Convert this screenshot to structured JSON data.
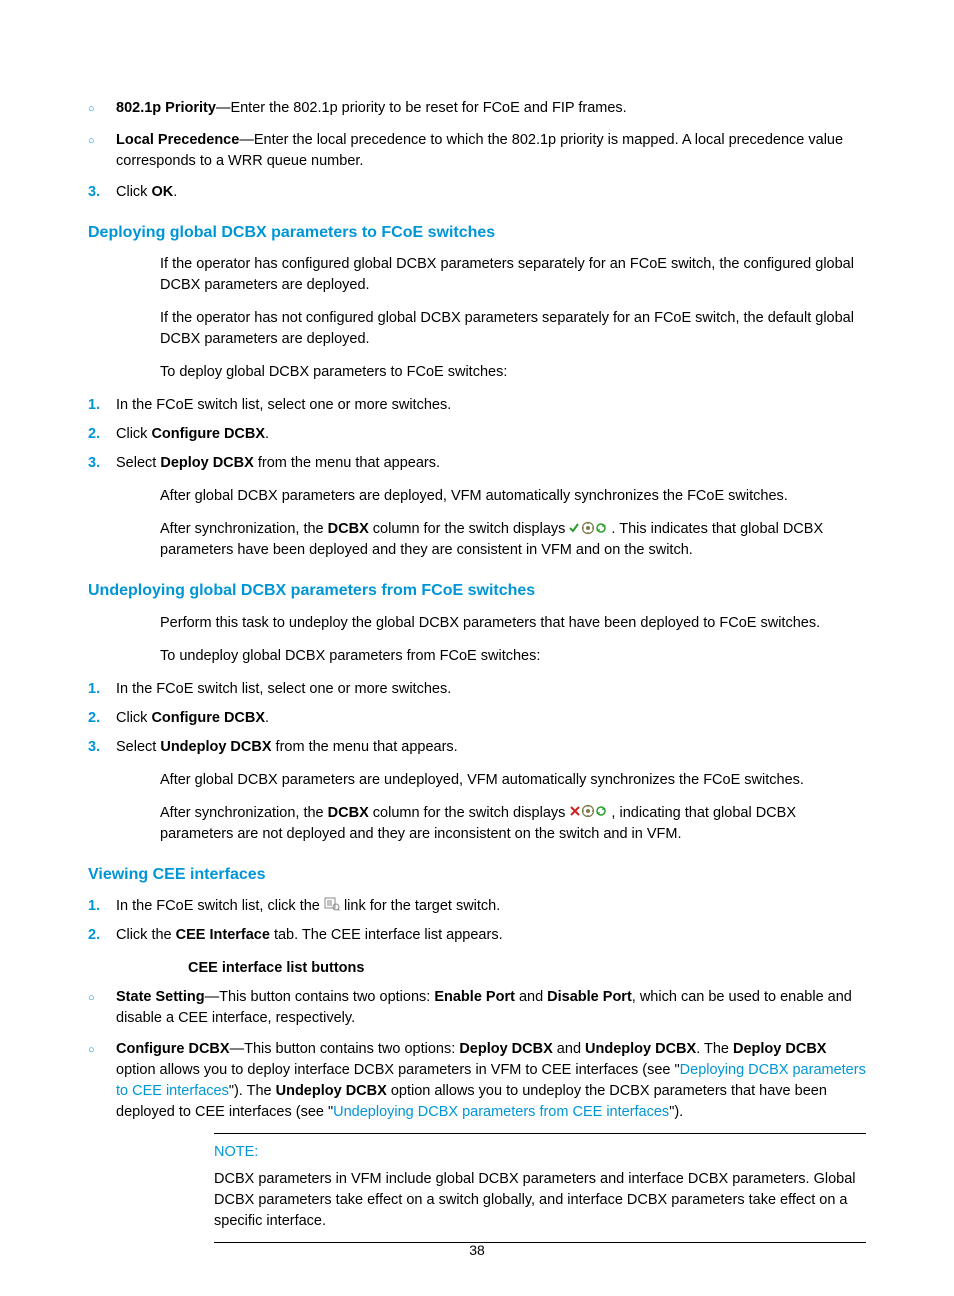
{
  "top": {
    "sub_items": {
      "i1": {
        "term": "802.1p Priority",
        "rest": "—Enter the 802.1p priority to be reset for FCoE and FIP frames."
      },
      "i2": {
        "term": "Local Precedence",
        "rest": "—Enter the local precedence to which the 802.1p priority is mapped. A local precedence value corresponds to a WRR queue number."
      }
    },
    "step3": {
      "n": "3.",
      "pre": "Click ",
      "ok": "OK",
      "post": "."
    }
  },
  "deploy": {
    "heading": "Deploying global DCBX parameters to FCoE switches",
    "p1": "If the operator has configured global DCBX parameters separately for an FCoE switch, the configured global DCBX parameters are deployed.",
    "p2": "If the operator has not configured global DCBX parameters separately for an FCoE switch, the default global DCBX parameters are deployed.",
    "p3": "To deploy global DCBX parameters to FCoE switches:",
    "steps": {
      "s1": {
        "n": "1.",
        "txt": "In the FCoE switch list, select one or more switches."
      },
      "s2": {
        "n": "2.",
        "pre": "Click ",
        "b": "Configure DCBX",
        "post": "."
      },
      "s3": {
        "n": "3.",
        "pre": "Select ",
        "b": "Deploy DCBX",
        "post": " from the menu that appears."
      }
    },
    "p4": "After global DCBX parameters are deployed, VFM automatically synchronizes the FCoE switches.",
    "p5a": "After synchronization, the ",
    "p5b": "DCBX",
    "p5c": " column for the switch displays ",
    "p5d": ". This indicates that global DCBX parameters have been deployed and they are consistent in VFM and on the switch."
  },
  "undeploy": {
    "heading": "Undeploying global DCBX parameters from FCoE switches",
    "p1": "Perform this task to undeploy the global DCBX parameters that have been deployed to FCoE switches.",
    "p2": "To undeploy global DCBX parameters from FCoE switches:",
    "steps": {
      "s1": {
        "n": "1.",
        "txt": "In the FCoE switch list, select one or more switches."
      },
      "s2": {
        "n": "2.",
        "pre": "Click ",
        "b": "Configure DCBX",
        "post": "."
      },
      "s3": {
        "n": "3.",
        "pre": "Select ",
        "b": "Undeploy DCBX",
        "post": " from the menu that appears."
      }
    },
    "p3": "After global DCBX parameters are undeployed, VFM automatically synchronizes the FCoE switches.",
    "p4a": "After synchronization, the ",
    "p4b": "DCBX",
    "p4c": " column for the switch displays ",
    "p4d": ", indicating that global DCBX parameters are not deployed and they are inconsistent on the switch and in VFM."
  },
  "cee": {
    "heading": "Viewing CEE interfaces",
    "steps": {
      "s1": {
        "n": "1.",
        "a": "In the FCoE switch list, click the ",
        "b": " link for the target switch."
      },
      "s2": {
        "n": "2.",
        "a": "Click the ",
        "bold": "CEE Interface",
        "b": " tab. The CEE interface list appears."
      }
    },
    "sub_head": "CEE interface list buttons",
    "items": {
      "i1": {
        "term": "State Setting",
        "a": "—This button contains two options: ",
        "b1": "Enable Port",
        "mid": " and ",
        "b2": "Disable Port",
        "c": ", which can be used to enable and disable a CEE interface, respectively."
      },
      "i2": {
        "term": "Configure DCBX",
        "a": "—This button contains two options: ",
        "b1": "Deploy DCBX",
        "mid1": " and ",
        "b2": "Undeploy DCBX",
        "c": ". The ",
        "b3": "Deploy DCBX",
        "d": " option allows you to deploy interface DCBX parameters in VFM to CEE interfaces (see \"",
        "link1": "Deploying DCBX parameters to CEE interfaces",
        "e": "\"). The ",
        "b4": "Undeploy DCBX",
        "f": " option allows you to undeploy the DCBX parameters that have been deployed to CEE interfaces (see \"",
        "link2": "Undeploying DCBX parameters from CEE interfaces",
        "g": "\")."
      }
    },
    "note": {
      "title": "NOTE:",
      "body": "DCBX parameters in VFM include global DCBX parameters and interface DCBX parameters. Global DCBX parameters take effect on a switch globally, and interface DCBX parameters take effect on a specific interface."
    }
  },
  "pagenum": "38"
}
